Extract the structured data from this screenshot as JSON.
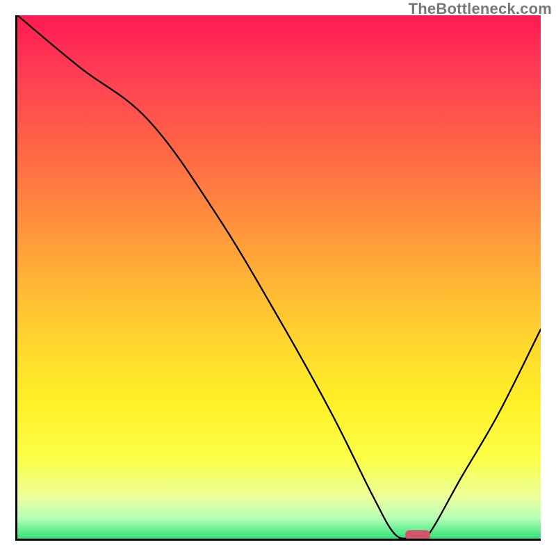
{
  "watermark": "TheBottleneck.com",
  "chart_data": {
    "type": "line",
    "title": "",
    "xlabel": "",
    "ylabel": "",
    "xlim": [
      0,
      100
    ],
    "ylim": [
      0,
      100
    ],
    "grid": false,
    "background": "vertical heatmap gradient (red=high at top, green=low at bottom)",
    "series": [
      {
        "name": "bottleneck-curve",
        "x": [
          0,
          12,
          25,
          38,
          50,
          60,
          68,
          72,
          75,
          78,
          85,
          92,
          100
        ],
        "values": [
          100,
          90,
          80,
          62,
          42,
          24,
          8,
          1,
          0,
          0,
          12,
          24,
          40
        ]
      }
    ],
    "marker": {
      "name": "optimal-point",
      "x": 76.5,
      "y": 0,
      "shape": "rounded-bar",
      "color": "#d1566a"
    }
  }
}
